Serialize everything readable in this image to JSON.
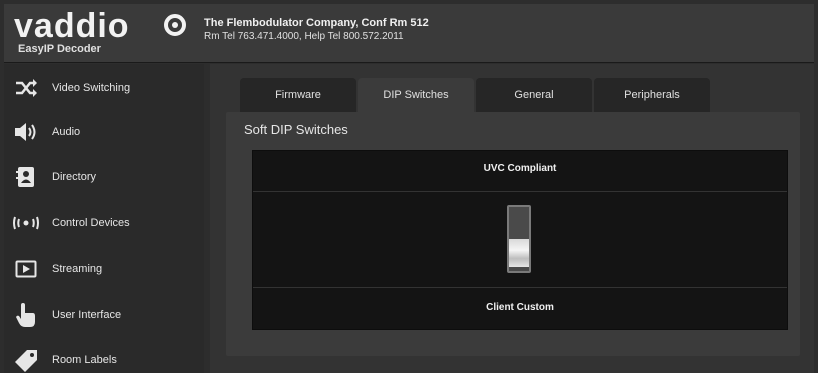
{
  "header": {
    "logo_text": "vaddio",
    "product_name": "EasyIP Decoder",
    "company_line": "The Flembodulator Company, Conf Rm 512",
    "phone_line": "Rm Tel 763.471.4000, Help Tel 800.572.2011"
  },
  "sidebar": {
    "items": [
      {
        "label": "Video Switching",
        "icon": "video-switching-icon"
      },
      {
        "label": "Audio",
        "icon": "speaker-icon"
      },
      {
        "label": "Directory",
        "icon": "directory-icon"
      },
      {
        "label": "Control Devices",
        "icon": "control-devices-icon"
      },
      {
        "label": "Streaming",
        "icon": "streaming-icon"
      },
      {
        "label": "User Interface",
        "icon": "hand-pointer-icon"
      },
      {
        "label": "Room Labels",
        "icon": "tag-icon"
      }
    ]
  },
  "tabs": [
    {
      "label": "Firmware",
      "active": false
    },
    {
      "label": "DIP Switches",
      "active": true
    },
    {
      "label": "General",
      "active": false
    },
    {
      "label": "Peripherals",
      "active": false
    }
  ],
  "panel": {
    "title": "Soft DIP Switches",
    "switch_top_label": "UVC Compliant",
    "switch_bottom_label": "Client Custom"
  },
  "colors": {
    "background": "#2d2d2d",
    "panel": "#3b3b3b",
    "switch_box": "#141414",
    "text": "#e6e6e6"
  }
}
